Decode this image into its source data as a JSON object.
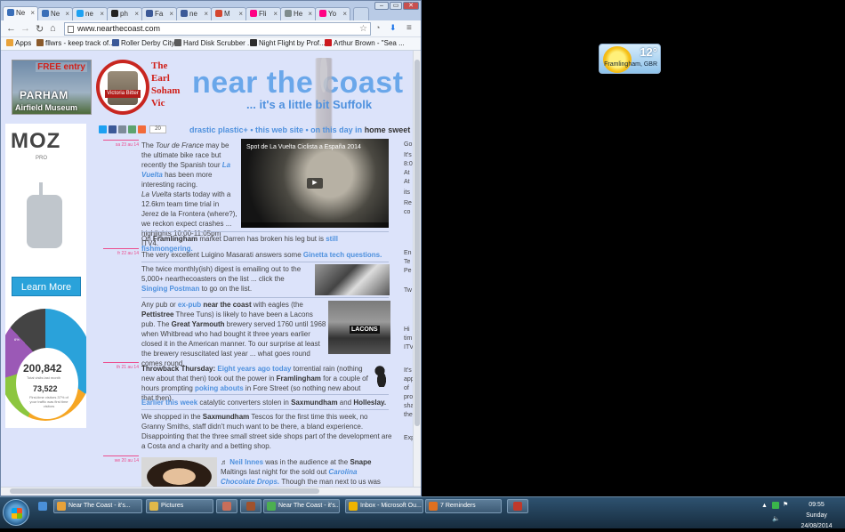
{
  "browser": {
    "tabs": [
      {
        "label": "Ne",
        "color": "#3a6fb8"
      },
      {
        "label": "Ne",
        "color": "#3a6fb8"
      },
      {
        "label": "ne",
        "color": "#1da1f2"
      },
      {
        "label": "ph",
        "color": "#222222"
      },
      {
        "label": "Fa",
        "color": "#3b5998"
      },
      {
        "label": "ne",
        "color": "#3b5998"
      },
      {
        "label": "M",
        "color": "#d4462f"
      },
      {
        "label": "Fli",
        "color": "#ff0084"
      },
      {
        "label": "He",
        "color": "#7f8c8d"
      },
      {
        "label": "Yo",
        "color": "#ff0084"
      }
    ],
    "url": "www.nearthecoast.com",
    "bookmarks": [
      {
        "label": "Apps",
        "color": "#e8a23a"
      },
      {
        "label": "fllwrs - keep track of...",
        "color": "#8a5a2b"
      },
      {
        "label": "Roller Derby City",
        "color": "#3b5998"
      },
      {
        "label": "Hard Disk Scrubber ...",
        "color": "#5a5a5a"
      },
      {
        "label": "Night Flight by Prof...",
        "color": "#2c2c2c"
      },
      {
        "label": "Arthur Brown - \"Sea ...",
        "color": "#cc181e"
      }
    ]
  },
  "page": {
    "header": {
      "ad1_free": "FREE entry",
      "ad1_title": "PARHAM",
      "ad1_sub": "Airfield Museum",
      "ad2_text": "Victoria Bitter",
      "vic_lines": [
        "The",
        "Earl",
        "Soham",
        "Vic"
      ],
      "site_title": "near the coast",
      "tagline": "... it's a little bit Suffolk"
    },
    "moz_ad": {
      "logo": "MOZ",
      "pro": "PRO",
      "button": "Learn More",
      "pct": "6%",
      "pie_label": "",
      "number1": "200,842",
      "sub1": "Total visits last month",
      "number2": "73,522",
      "sub2": "First-time visitors 37% of your traffic was first time visitors"
    },
    "share_count": "20",
    "nav": {
      "link1": "drastic plastic+",
      "link2": "this web site",
      "link3": "on this day in",
      "home": "home sweet home"
    },
    "video": {
      "title": "Spot de La Vuelta Ciclista a España 2014"
    },
    "posts": {
      "d1": "sa 23 au 14",
      "p1a": "The ",
      "p1b": "Tour de France",
      "p1c": " may be the ultimate bike race but recently the Spanish tour ",
      "p1d": "La Vuelta",
      "p1e": " has been more interesting racing.",
      "p1f": "La Vuelta",
      "p1g": " starts today with a 12.6km team time trial in Jerez de la Frontera (where?), we reckon expect crashes ... highlights 10:00-11:05pm ITV4.",
      "p2a": "On ",
      "p2b": "Framlingham",
      "p2c": " market Darren has broken his leg but is ",
      "p2d": "still fishmongering.",
      "d2": "fr 22 au 14",
      "p3a": "The very excellent Luigino Masarati answers some ",
      "p3b": "Ginetta tech questions.",
      "p4a": "The twice monthly(ish) digest is emailing out to the 5,000+ nearthecoasters on the list ... click the ",
      "p4b": "Singing Postman",
      "p4c": " to go on the list.",
      "p5a": "Any pub or ",
      "p5b": "ex-pub",
      "p5c": " near the coast",
      "p5d": " with eagles (the ",
      "p5e": "Pettistree",
      "p5f": " Three Tuns) is likely to have been a Lacons pub.  The ",
      "p5g": "Great Yarmouth",
      "p5h": " brewery served 1760 until 1968 when Whitbread who had bought it three years earlier closed it in the American manner.  To our surprise at least the brewery resuscitated last year ... what goes round comes round.",
      "img2_label": "LACONS",
      "d3": "th 21 au 14",
      "p6a": "Throwback Thursday:",
      "p6b": "Eight years ago today",
      "p6c": " torrential rain (nothing new about that then) took out the power in ",
      "p6d": "Framlingham",
      "p6e": " for a couple of hours prompting ",
      "p6f": "poking abouts",
      "p6g": " in Fore Street (so nothing new about that then).",
      "p7a": "Earlier this week",
      "p7b": " catalytic converters stolen in ",
      "p7c": "Saxmundham",
      "p7d": " and ",
      "p7e": "Holleslay.",
      "p8a": "We shopped in the ",
      "p8b": "Saxmundham",
      "p8c": " Tescos for the first time this week, no Granny Smiths, staff didn't much want to be there, a bland experience.  Disappointing that the three small street side shops part of the development are a Costa and a charity and a betting shop.",
      "d4": "we 20 au 14",
      "p9a": "♬ ",
      "p9b": "Neil Innes",
      "p9c": " was in the audience at the ",
      "p9d": "Snape",
      "p9e": " Maltings last night for the sold out ",
      "p9f": "Carolina Chocolate Drops.",
      "p9g": " Though the man next to us was finding the not particularly"
    },
    "right_col": [
      "Go",
      "It's",
      "8:0",
      "At",
      "At",
      "its",
      "Re",
      "co",
      "En",
      "Te",
      "Pe",
      "Tw",
      "Hi",
      "tim",
      "ITV",
      "It's",
      "app",
      "of",
      "pro",
      "sha",
      "the",
      "Exp"
    ]
  },
  "weather": {
    "temp": "12°",
    "city": "Framlingham, GBR"
  },
  "taskbar": {
    "items": [
      {
        "label": "Near The Coast - it's...",
        "color": "#e8a23a"
      },
      {
        "label": "Pictures",
        "color": "#e0b84a"
      },
      {
        "label": "Near The Coast - it's...",
        "color": "#4caf50"
      },
      {
        "label": "Inbox - Microsoft Ou...",
        "color": "#f0b400"
      },
      {
        "label": "7 Reminders",
        "color": "#e07020"
      }
    ],
    "time": "09:55",
    "day": "Sunday",
    "date": "24/08/2014"
  }
}
